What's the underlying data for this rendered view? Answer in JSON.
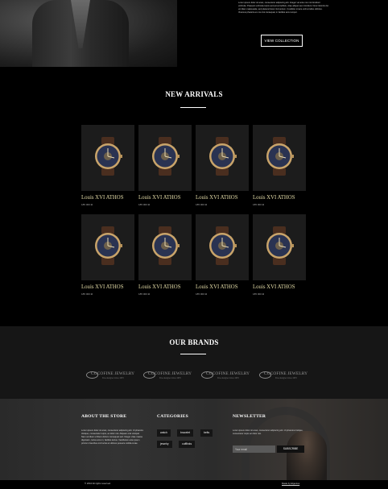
{
  "hero": {
    "text": "Lorem ipsum dolor sit amet, consectetur adipiscing elit. Integer vel ante non nisl tincidunt vehicula. Praesent vehicula turpis sed purus facilisis, vitae aliquet sem tincidunt. Nunc lobortis dui vel diam malesuada, sed placerat lorem fermentum. Curabitur ornare velit at tellus ultricies. Vivamus pharetra ex non dui consequat, in facilisis arcu tempor.",
    "button_label": "VIEW COLLECTION"
  },
  "new_arrivals": {
    "title": "NEW ARRIVALS",
    "products": [
      {
        "name": "Louis XVI ATHOS",
        "price": "185 000 ₪"
      },
      {
        "name": "Louis XVI ATHOS",
        "price": "185 000 ₪"
      },
      {
        "name": "Louis XVI ATHOS",
        "price": "185 000 ₪"
      },
      {
        "name": "Louis XVI ATHOS",
        "price": "185 000 ₪"
      },
      {
        "name": "Louis XVI ATHOS",
        "price": "185 000 ₪"
      },
      {
        "name": "Louis XVI ATHOS",
        "price": "185 000 ₪"
      },
      {
        "name": "Louis XVI ATHOS",
        "price": "185 000 ₪"
      },
      {
        "name": "Louis XVI ATHOS",
        "price": "185 000 ₪"
      }
    ]
  },
  "brands": {
    "title": "OUR BRANDS",
    "items": [
      {
        "name": "COCOFINE JEWELRY",
        "tagline": "Fine designer since 1970"
      },
      {
        "name": "COCOFINE JEWELRY",
        "tagline": "Fine designer since 1970"
      },
      {
        "name": "COCOFINE JEWELRY",
        "tagline": "Fine designer since 1970"
      },
      {
        "name": "COCOFINE JEWELRY",
        "tagline": "Fine designer since 1970"
      }
    ]
  },
  "footer": {
    "about": {
      "title": "ABOUT THE STORE",
      "text": "Lorem ipsum dolor sit amet, consectetur adipiscing elit. Ut pharetra tristique, consectetur turpis, ac dolor nisi. Aliquam erat volutpat. Nam vel diam ut libero dictum consequat sed. Integer vitae massa dignissim, luctus arcu in, facilisis lectus. Vestibulum ante ipsum primis in faucibus orci luctus et ultrices posuere cubilia curae."
    },
    "categories": {
      "title": "CATEGORIES",
      "items": [
        "watch",
        "bracelet",
        "belts",
        "jewelry",
        "cufflinks"
      ]
    },
    "newsletter": {
      "title": "NEWSLETTER",
      "text": "Lorem ipsum dolor sit amet, consectetur adipiscing elit. Ut pharetra tristique, consectetur turpis ac dolor nisi.",
      "placeholder": "Your email",
      "button_label": "SUBSCRIBE"
    },
    "copyright": "© 2016 All rights reserved.",
    "credit": "Made by Elgenius"
  },
  "colors": {
    "accent_gold": "#e4dca8",
    "background": "#000000",
    "brands_bg": "#161616"
  }
}
